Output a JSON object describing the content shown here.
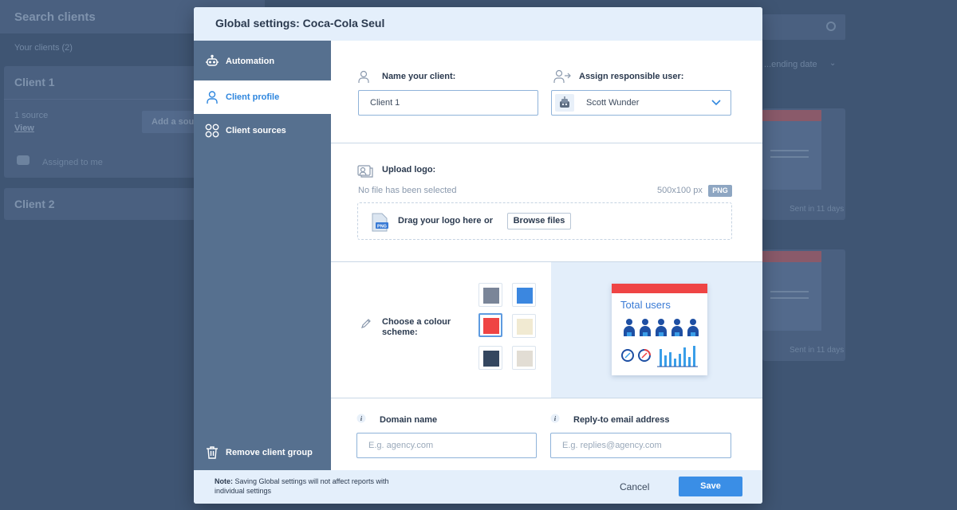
{
  "background": {
    "search_placeholder": "Search clients",
    "your_clients": "Your clients (2)",
    "client1": {
      "title": "Client 1",
      "sources": "1 source",
      "view": "View",
      "add_source": "Add a source",
      "assigned": "Assigned to me"
    },
    "client2": {
      "title": "Client 2"
    },
    "sort_label": "...ending date",
    "sent_label_1": "Sent in 11 days",
    "sent_label_2": "Sent in 11 days"
  },
  "modal": {
    "title": "Global settings: Coca-Cola Seul",
    "sidebar": {
      "items": [
        {
          "label": "Automation",
          "icon": "robot-icon",
          "active": false
        },
        {
          "label": "Client profile",
          "icon": "user-icon",
          "active": true
        },
        {
          "label": "Client sources",
          "icon": "sources-icon",
          "active": false
        }
      ],
      "remove_label": "Remove client group"
    },
    "client_name": {
      "label": "Name your client:",
      "value": "Client 1"
    },
    "responsible_user": {
      "label": "Assign responsible user:",
      "value": "Scott Wunder"
    },
    "logo": {
      "label": "Upload logo:",
      "status": "No file has been selected",
      "dimensions": "500x100 px",
      "format": "PNG",
      "drag_text": "Drag your logo here",
      "or_text": "or",
      "browse_label": "Browse files",
      "file_badge": "PNG"
    },
    "colour": {
      "label": "Choose a colour scheme:",
      "swatches": [
        "#7a8598",
        "#3b87e0",
        "#ef4444",
        "#f1ead2",
        "#34465f",
        "#e2ddd4"
      ],
      "selected_index": 2,
      "preview_title": "Total users"
    },
    "domain": {
      "label": "Domain name",
      "placeholder": "E.g. agency.com"
    },
    "reply_to": {
      "label": "Reply-to email address",
      "placeholder": "E.g. replies@agency.com"
    },
    "footer": {
      "note_bold": "Note:",
      "note_text": "Saving Global settings will not affect reports with individual settings",
      "cancel_label": "Cancel",
      "save_label": "Save"
    }
  }
}
